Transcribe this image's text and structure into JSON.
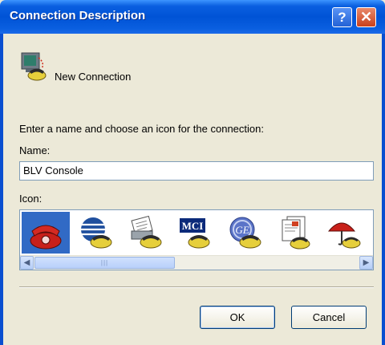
{
  "window": {
    "title": "Connection Description",
    "help_glyph": "?",
    "close_glyph": "✕",
    "titlebar_color": "#0053d6"
  },
  "header": {
    "icon": "connection-icon",
    "text": "New Connection"
  },
  "form": {
    "prompt": "Enter a name and choose an icon for the connection:",
    "name_label": "Name:",
    "name_value": "BLV Console",
    "icon_label": "Icon:"
  },
  "icons": [
    {
      "name": "red-phone-icon",
      "selected": true
    },
    {
      "name": "globe-phone-icon",
      "selected": false
    },
    {
      "name": "fax-phone-icon",
      "selected": false
    },
    {
      "name": "mci-phone-icon",
      "selected": false
    },
    {
      "name": "ge-phone-icon",
      "selected": false
    },
    {
      "name": "document-phone-icon",
      "selected": false
    },
    {
      "name": "umbrella-phone-icon",
      "selected": false
    }
  ],
  "scrollbar": {
    "left_glyph": "◀",
    "right_glyph": "▶",
    "grip": "|||"
  },
  "buttons": {
    "ok": "OK",
    "cancel": "Cancel"
  }
}
